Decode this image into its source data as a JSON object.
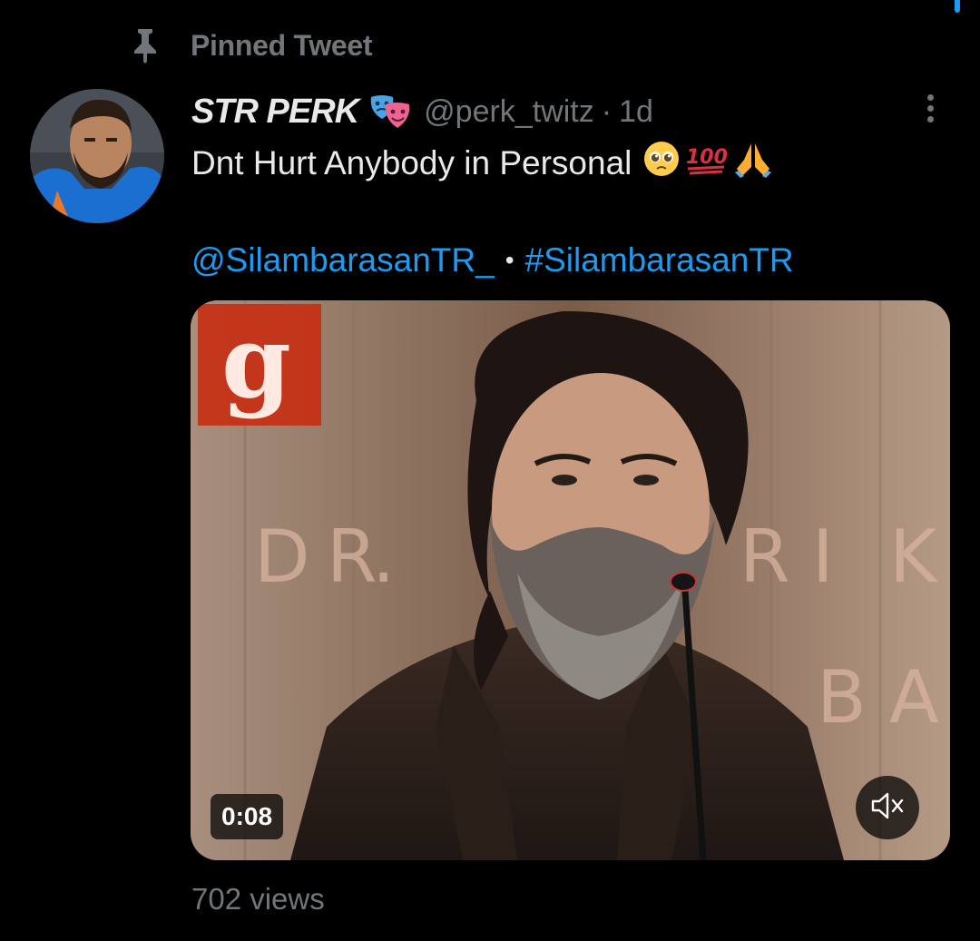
{
  "pinned": {
    "label": "Pinned Tweet",
    "icon": "pin-icon"
  },
  "author": {
    "display_name": "STR PERK",
    "badge_emoji": "🎭",
    "handle": "@perk_twitz",
    "separator": "·",
    "time": "1d"
  },
  "tweet": {
    "text": "Dnt Hurt Anybody in Personal",
    "emojis": [
      "🥺",
      "💯",
      "🙏"
    ],
    "mention": "@SilambarasanTR_",
    "bullet": "•",
    "hashtag": "#SilambarasanTR"
  },
  "media": {
    "duration": "0:08",
    "muted": true,
    "backdrop_letters": [
      "D",
      "R",
      ".",
      "R",
      "I",
      "K",
      "B",
      "A"
    ],
    "logo_letter": "g"
  },
  "stats": {
    "views": "702 views"
  },
  "colors": {
    "accent": "#1d9bf0",
    "muted_text": "#71767b",
    "text": "#e7e9ea",
    "background": "#000000"
  }
}
